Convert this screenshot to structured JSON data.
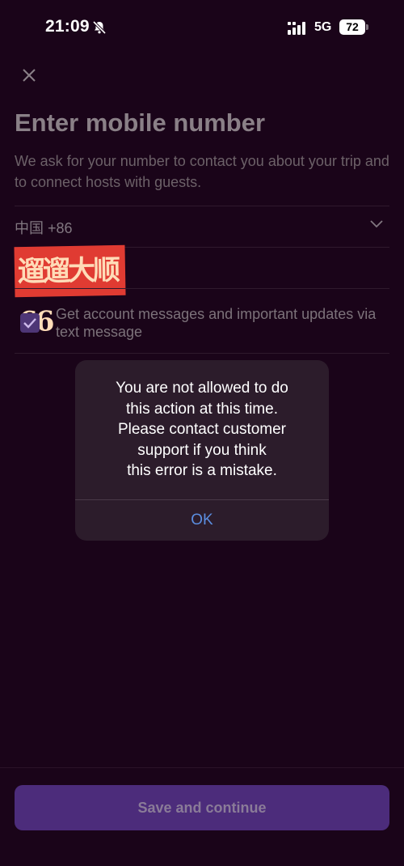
{
  "status_bar": {
    "time": "21:09",
    "network": "5G",
    "battery": "72"
  },
  "header": {
    "close_icon": "close-icon"
  },
  "form": {
    "title": "Enter mobile number",
    "subtitle": "We ask for your number to contact you about your trip and to connect hosts with guests.",
    "country_code": "中国 +86",
    "stamp_text": "遛遛大顺66",
    "checkbox_checked": true,
    "checkbox_label": "Get account messages and important updates via text message"
  },
  "alert": {
    "message": "You are not allowed to do\nthis action at this time.\nPlease contact customer\nsupport if you think\nthis error is a mistake.",
    "ok_label": "OK"
  },
  "footer": {
    "save_label": "Save and continue"
  },
  "colors": {
    "background": "#1a0419",
    "accent": "#4c2c7b",
    "alert_link": "#5b8de0"
  }
}
